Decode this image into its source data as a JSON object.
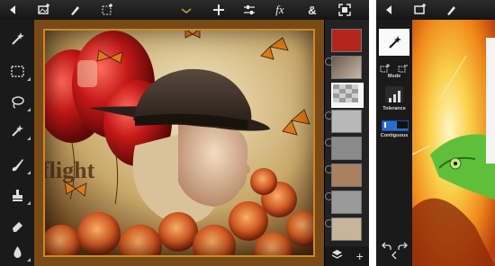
{
  "device_left": {
    "toolbar": {
      "back_icon": "back-arrow-icon",
      "items": [
        "image-add-icon",
        "brush-icon",
        "selection-icon",
        "add-icon",
        "adjustments-icon",
        "fx",
        "&",
        "fullscreen-icon"
      ],
      "fx_label": "fx",
      "amp_label": "&"
    },
    "tools": [
      "magic-wand-icon",
      "marquee-icon",
      "lasso-icon",
      "refine-edge-icon",
      "brush-icon",
      "stamp-icon",
      "eraser-icon",
      "drop-icon"
    ],
    "canvas": {
      "text": "flight",
      "colors": {
        "frame": "#7a4a16",
        "balloon": "#c41818",
        "rose": "#d15a22",
        "sky": "#e9d8a8"
      }
    },
    "layers": {
      "count": 8,
      "selected_index": 2,
      "add_label": "+"
    }
  },
  "device_right": {
    "toolbar": {
      "items": [
        "back-arrow-icon",
        "image-add-icon",
        "brush-icon"
      ]
    },
    "panel": {
      "mode_label": "Mode",
      "tolerance_label": "Tolerance",
      "contiguous_label": "Contiguous"
    }
  }
}
